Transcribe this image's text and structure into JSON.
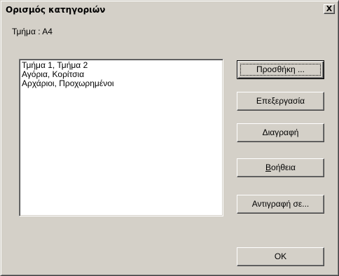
{
  "window": {
    "title": "Ορισμός κατηγοριών",
    "close_glyph": "X"
  },
  "section": {
    "label": "Τμήμα :  Α4"
  },
  "categories": [
    "Τμήμα 1, Τμήμα 2",
    "Αγόρια, Κορίτσια",
    "Αρχάριοι, Προχωρημένοι"
  ],
  "buttons": {
    "add": "Προσθήκη ...",
    "edit": "Επεξεργασία",
    "delete": "Διαγραφή",
    "help": "Βοήθεια",
    "copy_to": "Αντιγραφή σε...",
    "ok": "OK"
  }
}
